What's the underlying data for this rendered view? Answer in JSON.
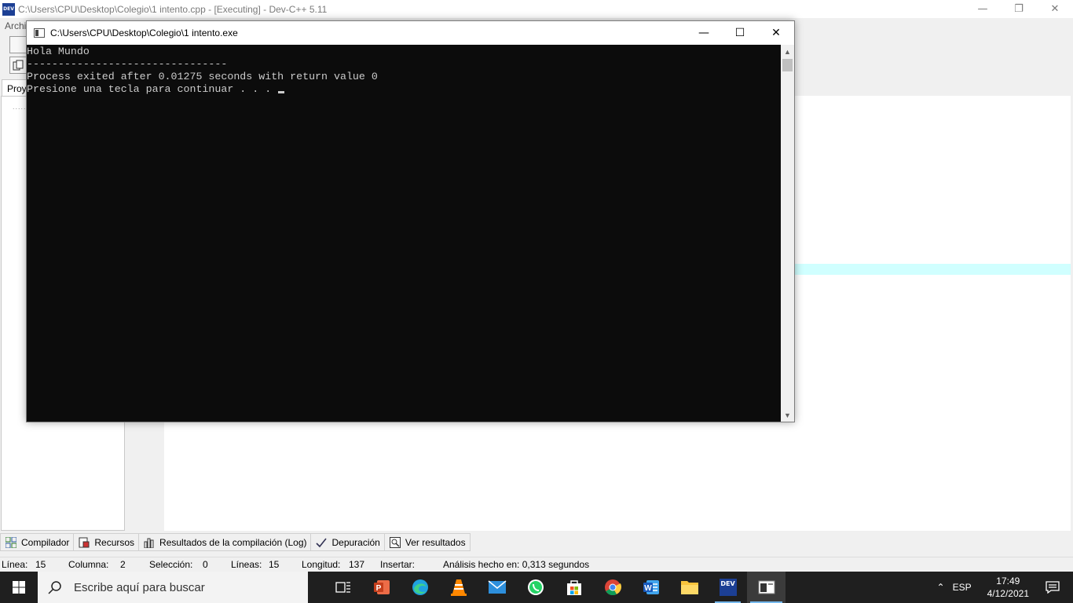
{
  "devcpp": {
    "title": "C:\\Users\\CPU\\Desktop\\Colegio\\1 intento.cpp - [Executing] - Dev-C++ 5.11",
    "app_icon_text": "DEV",
    "menu_partial": "Archi",
    "project_tab": "Proy",
    "bottom_tabs": [
      {
        "label": "Compilador",
        "icon": "grid-icon"
      },
      {
        "label": "Recursos",
        "icon": "resources-icon"
      },
      {
        "label": "Resultados de la compilación (Log)",
        "icon": "bar-chart-icon"
      },
      {
        "label": "Depuración",
        "icon": "checkmark-icon"
      },
      {
        "label": "Ver resultados",
        "icon": "magnifier-icon"
      }
    ],
    "status": {
      "linea_label": "Línea:",
      "linea_value": "15",
      "columna_label": "Columna:",
      "columna_value": "2",
      "seleccion_label": "Selección:",
      "seleccion_value": "0",
      "lineas_label": "Líneas:",
      "lineas_value": "15",
      "longitud_label": "Longitud:",
      "longitud_value": "137",
      "insertar_label": "Insertar:",
      "analisis": "Análisis hecho en: 0,313 segundos"
    },
    "highlight_color": "#d0ffff"
  },
  "console": {
    "title": "C:\\Users\\CPU\\Desktop\\Colegio\\1 intento.exe",
    "lines": [
      "Hola Mundo",
      "--------------------------------",
      "Process exited after 0.01275 seconds with return value 0",
      "Presione una tecla para continuar . . . "
    ],
    "bg_color": "#0c0c0c",
    "text_color": "#cccccc"
  },
  "taskbar": {
    "search_placeholder": "Escribe aquí para buscar",
    "apps": [
      "task-view-icon",
      "powerpoint-icon",
      "edge-icon",
      "vlc-icon",
      "mail-icon",
      "whatsapp-icon",
      "store-icon",
      "chrome-icon",
      "word-icon",
      "file-explorer-icon",
      "devcpp-icon",
      "console-icon"
    ],
    "devcpp_label": "DEV",
    "language": "ESP",
    "time": "17:49",
    "date": "4/12/2021",
    "accent": "#76b9ed"
  }
}
